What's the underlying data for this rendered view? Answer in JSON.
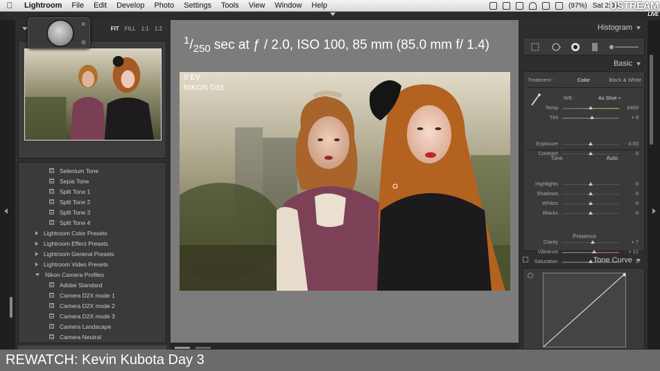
{
  "menubar": {
    "app_name": "Lightroom",
    "menus": [
      "File",
      "Edit",
      "Develop",
      "Photo",
      "Settings",
      "Tools",
      "View",
      "Window",
      "Help"
    ],
    "battery": "(97%)",
    "clock": "Sat 2:03"
  },
  "stream": {
    "brand": "USTREAM",
    "live": "LIVE"
  },
  "navigator": {
    "zoom_fit": "FIT",
    "zoom_fill": "FILL",
    "zoom_1to1": "1:1",
    "zoom_1to2": "1:2"
  },
  "presets": {
    "items": [
      {
        "label": "Selenium Tone",
        "kind": "preset"
      },
      {
        "label": "Sepia Tone",
        "kind": "preset"
      },
      {
        "label": "Split Tone 1",
        "kind": "preset"
      },
      {
        "label": "Split Tone 2",
        "kind": "preset"
      },
      {
        "label": "Split Tone 3",
        "kind": "preset"
      },
      {
        "label": "Split Tone 4",
        "kind": "preset"
      },
      {
        "label": "Lightroom Color Presets",
        "kind": "folder-closed"
      },
      {
        "label": "Lightroom Effect Presets",
        "kind": "folder-closed"
      },
      {
        "label": "Lightroom General Presets",
        "kind": "folder-closed"
      },
      {
        "label": "Lightroom Video Presets",
        "kind": "folder-closed"
      },
      {
        "label": "Nikon Camera Profiles",
        "kind": "folder-open"
      },
      {
        "label": "Adobe Standard",
        "kind": "preset"
      },
      {
        "label": "Camera D2X mode 1",
        "kind": "preset"
      },
      {
        "label": "Camera D2X mode 2",
        "kind": "preset"
      },
      {
        "label": "Camera D2X mode 3",
        "kind": "preset"
      },
      {
        "label": "Camera Landscape",
        "kind": "preset"
      },
      {
        "label": "Camera Neutral",
        "kind": "preset"
      }
    ]
  },
  "photo_info": {
    "shutter_num": "1",
    "shutter_den": "250",
    "exposure_rest": " sec at ƒ / 2.0, ISO 100, 85 mm (85.0 mm f/ 1.4)",
    "ev": "0 EV",
    "camera": "NIKON D3S"
  },
  "right_panel": {
    "histogram_label": "Histogram",
    "basic_label": "Basic",
    "treatment_label": "Treatment :",
    "treatment_color": "Color",
    "treatment_bw": "Black & White",
    "wb_label": "WB :",
    "wb_value": "As Shot ÷",
    "tone_label": "Tone",
    "auto_label": "Auto",
    "presence_label": "Presence",
    "tone_curve_label": "Tone Curve",
    "sliders": [
      {
        "label": "Temp",
        "value": "6400",
        "pos": 0.5
      },
      {
        "label": "Tint",
        "value": "+ 9",
        "pos": 0.53
      },
      {
        "label": "Exposure",
        "value": "0.00",
        "pos": 0.5
      },
      {
        "label": "Contrast",
        "value": "0",
        "pos": 0.5
      },
      {
        "label": "Highlights",
        "value": "0",
        "pos": 0.5
      },
      {
        "label": "Shadows",
        "value": "0",
        "pos": 0.5
      },
      {
        "label": "Whites",
        "value": "0",
        "pos": 0.5
      },
      {
        "label": "Blacks",
        "value": "0",
        "pos": 0.5
      },
      {
        "label": "Clarity",
        "value": "+ 7",
        "pos": 0.54
      },
      {
        "label": "Vibrance",
        "value": "+ 12",
        "pos": 0.56
      },
      {
        "label": "Saturation",
        "value": "0",
        "pos": 0.5
      }
    ]
  },
  "caption": {
    "text": "REWATCH: Kevin Kubota Day 3"
  },
  "colors": {
    "panel": "#2e2e2e",
    "center_bg": "#7c7c7c",
    "caption_bg": "#6b6b6b"
  }
}
